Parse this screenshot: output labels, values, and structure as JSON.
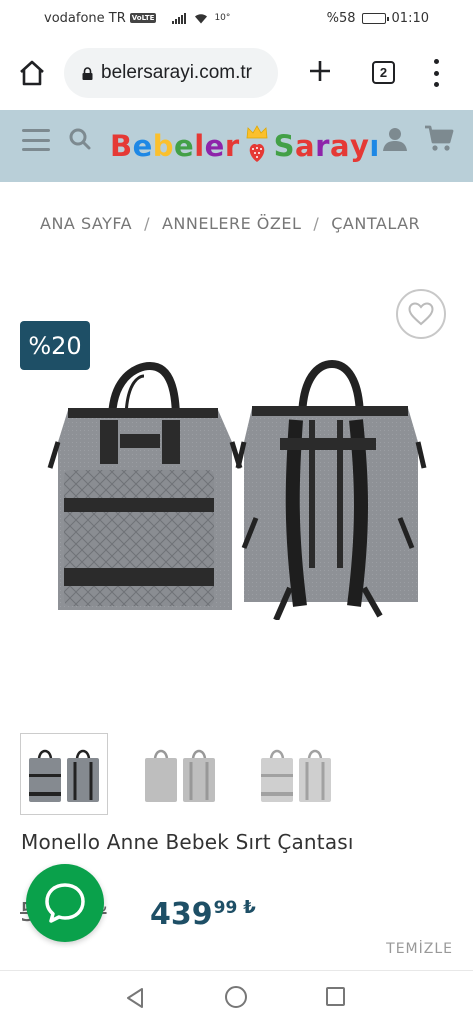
{
  "status_bar": {
    "carrier": "vodafone TR",
    "volte": "VoLTE",
    "temp": "10°",
    "battery_percent": "%58",
    "battery_level": 0.58,
    "time": "01:10"
  },
  "browser": {
    "url": "belersarayi.com.tr",
    "tab_count": "2"
  },
  "site_header": {
    "logo_left": "Bebeler",
    "logo_right": "Sarayı",
    "logo_colors": [
      "#e53935",
      "#1e88e5",
      "#fbc02d",
      "#43a047",
      "#e53935",
      "#8e24aa",
      "#e53935"
    ]
  },
  "breadcrumb": {
    "items": [
      "ANA SAYFA",
      "ANNELERE ÖZEL",
      "ÇANTALAR"
    ],
    "separator": "/"
  },
  "product": {
    "discount_badge": "%20",
    "title": "Monello Anne Bebek Sırt Çantası",
    "old_price": "549",
    "old_price_decimal": "99",
    "old_price_currency": "₺",
    "new_price": "439",
    "new_price_decimal": "99",
    "new_price_currency": "₺",
    "thumbnail_count": 3,
    "accent_color": "#1e4f66"
  },
  "actions": {
    "clear_label": "TEMİZLE"
  },
  "icons": {
    "home": "home-icon",
    "lock": "lock-icon",
    "new_tab": "plus-icon",
    "menu": "more-vert-icon",
    "site_menu": "hamburger-icon",
    "search": "search-icon",
    "account": "user-icon",
    "cart": "cart-icon",
    "wishlist": "heart-icon",
    "chat": "chat-icon"
  }
}
